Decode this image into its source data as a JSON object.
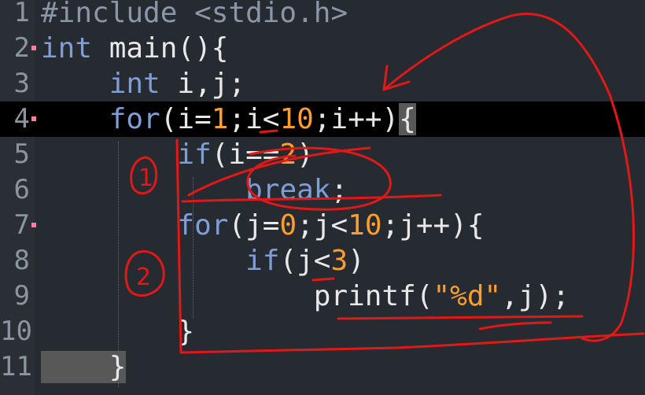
{
  "lines": [
    {
      "n": "1",
      "tokens": [
        {
          "t": "#include <stdio.h>",
          "c": "pp"
        }
      ]
    },
    {
      "n": "2",
      "tokens": [
        {
          "t": "int",
          "c": "kw"
        },
        {
          "t": " main(){",
          "c": "plain"
        }
      ]
    },
    {
      "n": "3",
      "tokens": [
        {
          "t": "    ",
          "c": "plain"
        },
        {
          "t": "int",
          "c": "kw"
        },
        {
          "t": " i,j;",
          "c": "plain"
        }
      ]
    },
    {
      "n": "4",
      "tokens": [
        {
          "t": "    ",
          "c": "plain"
        },
        {
          "t": "for",
          "c": "kw"
        },
        {
          "t": "(i=",
          "c": "plain"
        },
        {
          "t": "1",
          "c": "num"
        },
        {
          "t": ";i<",
          "c": "plain"
        },
        {
          "t": "10",
          "c": "num"
        },
        {
          "t": ";i++)",
          "c": "plain"
        },
        {
          "t": "{",
          "c": "brace-hl"
        }
      ]
    },
    {
      "n": "5",
      "tokens": [
        {
          "t": "        ",
          "c": "plain"
        },
        {
          "t": "if",
          "c": "kw"
        },
        {
          "t": "(i==",
          "c": "plain"
        },
        {
          "t": "2",
          "c": "num"
        },
        {
          "t": ")",
          "c": "plain"
        }
      ]
    },
    {
      "n": "6",
      "tokens": [
        {
          "t": "            ",
          "c": "plain"
        },
        {
          "t": "break",
          "c": "kw"
        },
        {
          "t": ";",
          "c": "plain"
        }
      ]
    },
    {
      "n": "7",
      "tokens": [
        {
          "t": "        ",
          "c": "plain"
        },
        {
          "t": "for",
          "c": "kw"
        },
        {
          "t": "(j=",
          "c": "plain"
        },
        {
          "t": "0",
          "c": "num"
        },
        {
          "t": ";j<",
          "c": "plain"
        },
        {
          "t": "10",
          "c": "num"
        },
        {
          "t": ";j++){",
          "c": "plain"
        }
      ]
    },
    {
      "n": "8",
      "tokens": [
        {
          "t": "            ",
          "c": "plain"
        },
        {
          "t": "if",
          "c": "kw"
        },
        {
          "t": "(j<",
          "c": "plain"
        },
        {
          "t": "3",
          "c": "num"
        },
        {
          "t": ")",
          "c": "plain"
        }
      ]
    },
    {
      "n": "9",
      "tokens": [
        {
          "t": "                ",
          "c": "plain"
        },
        {
          "t": "printf(",
          "c": "plain"
        },
        {
          "t": "\"%d\"",
          "c": "str"
        },
        {
          "t": ",j);",
          "c": "plain"
        }
      ]
    },
    {
      "n": "10",
      "tokens": [
        {
          "t": "        }",
          "c": "plain"
        }
      ]
    },
    {
      "n": "11",
      "tokens": [
        {
          "t": "    }",
          "c": "brace-hl"
        }
      ]
    }
  ],
  "annotations": {
    "label_1": "1",
    "label_2": "2"
  },
  "colors": {
    "background": "#262a31",
    "current_line": "#000000",
    "keyword": "#7f9ed6",
    "number": "#ff9d2e",
    "ink": "#e01818"
  }
}
